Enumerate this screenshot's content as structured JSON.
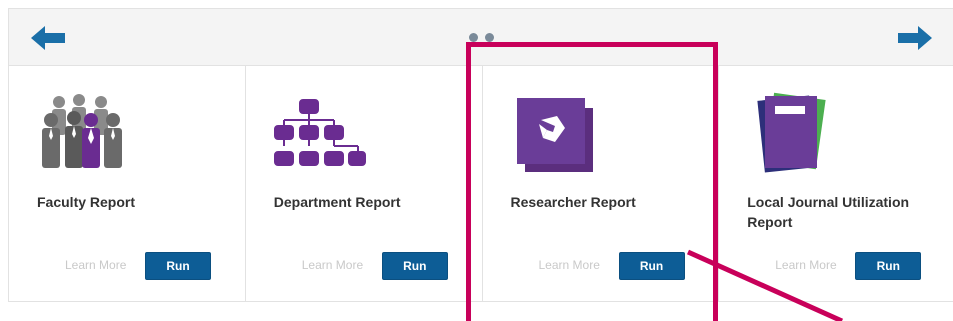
{
  "colors": {
    "accent": "#1a6fa8",
    "run_button": "#0d5d96",
    "purple": "#6a2c91",
    "icon_gray": "#707070",
    "annotation": "#c8005a",
    "dot": "#7a8a99"
  },
  "carousel": {
    "prev_icon": "arrow-left-icon",
    "next_icon": "arrow-right-icon",
    "page_count": 2
  },
  "cards": [
    {
      "title": "Faculty Report",
      "icon": "faculty-people-icon",
      "learn_more": "Learn More",
      "run": "Run"
    },
    {
      "title": "Department Report",
      "icon": "org-chart-icon",
      "learn_more": "Learn More",
      "run": "Run"
    },
    {
      "title": "Researcher Report",
      "icon": "researcher-logo-icon",
      "learn_more": "Learn More",
      "run": "Run"
    },
    {
      "title": "Local Journal Utilization Report",
      "icon": "journals-icon",
      "learn_more": "Learn More",
      "run": "Run"
    }
  ]
}
